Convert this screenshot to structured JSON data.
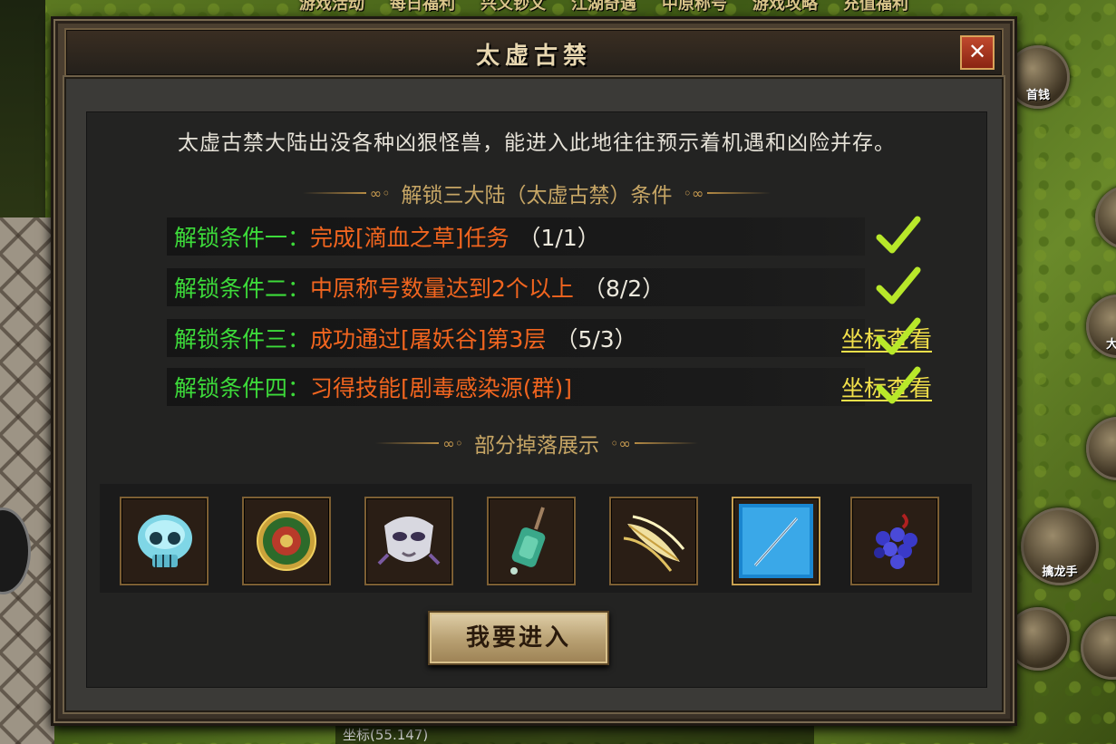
{
  "background": {
    "top_menu": [
      "游戏活动",
      "每日福利",
      "兴义钞文",
      "江湖奇遇",
      "中原称号",
      "游戏攻略",
      "充值福利"
    ],
    "side_buttons": [
      "首钱",
      "",
      "大陆",
      "",
      "擒龙手",
      "",
      ""
    ],
    "bottom_text": "坐标(55.147)"
  },
  "dialog": {
    "title": "太虚古禁",
    "close_icon": "close-icon",
    "description": "太虚古禁大陆出没各种凶狠怪兽，能进入此地往往预示着机遇和凶险并存。",
    "conditions_title": "解锁三大陆（太虚古禁）条件",
    "conditions": [
      {
        "label": "解锁条件一：",
        "text": "完成[滴血之草]任务",
        "progress": "（1/1）",
        "link": "",
        "done": true
      },
      {
        "label": "解锁条件二：",
        "text": "中原称号数量达到2个以上",
        "progress": "（8/2）",
        "link": "",
        "done": true
      },
      {
        "label": "解锁条件三：",
        "text": "成功通过[屠妖谷]第3层",
        "progress": "（5/3）",
        "link": "坐标查看",
        "done": true
      },
      {
        "label": "解锁条件四：",
        "text": "习得技能[剧毒感染源(群)]",
        "progress": "",
        "link": "坐标查看",
        "done": true
      }
    ],
    "drops_title": "部分掉落展示",
    "drops": [
      {
        "icon": "ice-skull-icon"
      },
      {
        "icon": "jade-medallion-icon"
      },
      {
        "icon": "silver-mask-icon"
      },
      {
        "icon": "jade-pendant-icon"
      },
      {
        "icon": "golden-feather-icon"
      },
      {
        "icon": "blue-needle-icon"
      },
      {
        "icon": "grape-cluster-icon"
      }
    ],
    "enter_button": "我要进入"
  },
  "colors": {
    "condition_label": "#3ddb3a",
    "condition_text": "#f1651f",
    "link": "#f2e04a",
    "check": "#b8e82a",
    "title_gold": "#c7a665"
  }
}
